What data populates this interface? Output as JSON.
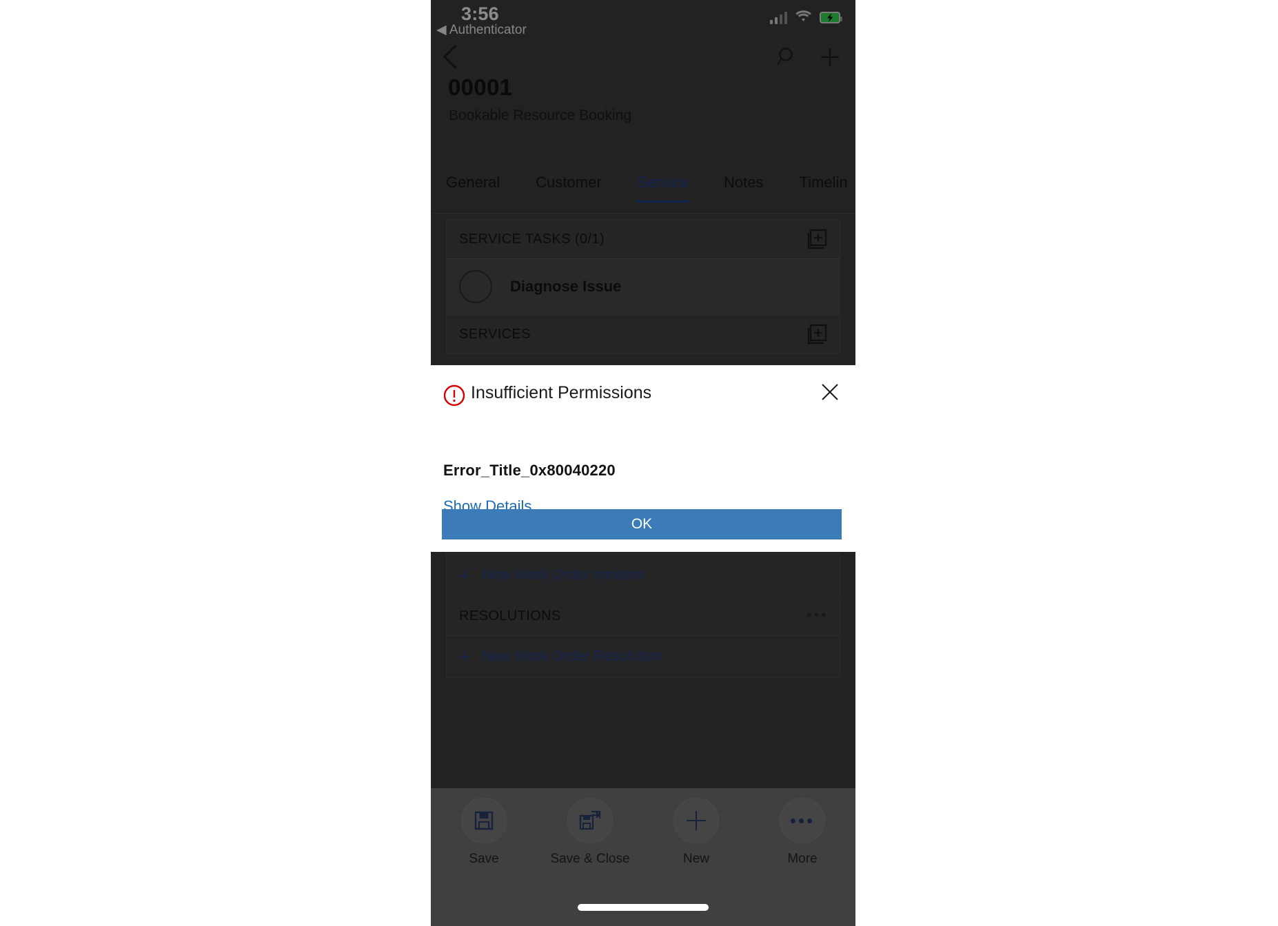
{
  "status_bar": {
    "time": "3:56",
    "return_app": "◀ Authenticator",
    "icons": [
      "signal-icon",
      "wifi-icon",
      "battery-charging-icon"
    ],
    "battery_color": "#2fd34d"
  },
  "header": {
    "back_icon": "chevron-left-icon",
    "search_icon": "search-icon",
    "add_icon": "plus-icon",
    "title": "00001",
    "subtitle": "Bookable Resource Booking"
  },
  "tabs": [
    {
      "label": "General",
      "active": false
    },
    {
      "label": "Customer",
      "active": false
    },
    {
      "label": "Service",
      "active": true
    },
    {
      "label": "Notes",
      "active": false
    },
    {
      "label": "Timelin",
      "active": false
    }
  ],
  "tab_accent": "#203f91",
  "sections": {
    "service_tasks": {
      "label": "SERVICE TASKS (0/1)",
      "action_icon": "add-record-icon",
      "rows": [
        {
          "label": "Diagnose Issue",
          "checked": false
        }
      ]
    },
    "services": {
      "label": "SERVICES",
      "action_icon": "add-record-icon"
    },
    "incidents_link": {
      "label": "New Work Order Incident",
      "icon": "plus-icon"
    },
    "resolutions": {
      "label": "RESOLUTIONS",
      "action_icon": "more-ellipsis-icon"
    },
    "resolutions_link": {
      "label": "New Work Order Resolution",
      "icon": "plus-icon"
    }
  },
  "dialog": {
    "icon": "error-circle-icon",
    "icon_color": "#d60000",
    "title": "Insufficient Permissions",
    "close_icon": "close-icon",
    "message": "Error_Title_0x80040220",
    "details_link": "Show Details",
    "ok_label": "OK",
    "ok_color": "#3b7cb8"
  },
  "command_bar": {
    "items": [
      {
        "label": "Save",
        "icon": "save-icon"
      },
      {
        "label": "Save & Close",
        "icon": "save-and-close-icon"
      },
      {
        "label": "New",
        "icon": "plus-icon"
      },
      {
        "label": "More",
        "icon": "more-ellipsis-icon"
      }
    ]
  }
}
